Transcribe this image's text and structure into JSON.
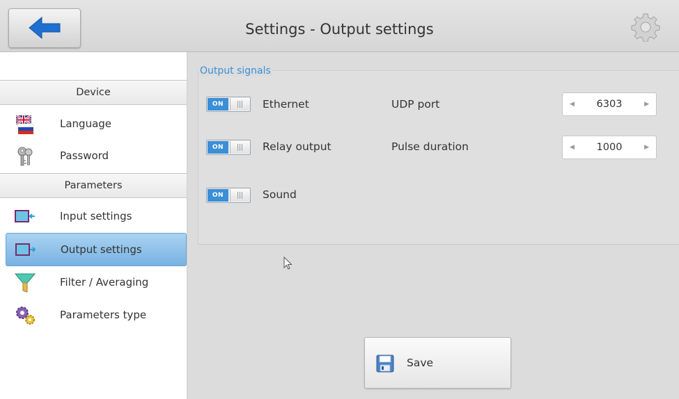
{
  "header": {
    "title": "Settings - Output settings",
    "back_icon": "left-arrow-icon",
    "settings_icon": "gear-icon"
  },
  "sidebar": {
    "sections": [
      {
        "label": "Device",
        "items": [
          {
            "label": "Language",
            "icon": "flags-icon",
            "active": false
          },
          {
            "label": "Password",
            "icon": "keys-icon",
            "active": false
          }
        ]
      },
      {
        "label": "Parameters",
        "items": [
          {
            "label": "Input settings",
            "icon": "input-monitor-icon",
            "active": false
          },
          {
            "label": "Output settings",
            "icon": "output-monitor-icon",
            "active": true
          },
          {
            "label": "Filter / Averaging",
            "icon": "funnel-icon",
            "active": false
          },
          {
            "label": "Parameters type",
            "icon": "gears-icon",
            "active": false
          }
        ]
      }
    ]
  },
  "main": {
    "group_title": "Output signals",
    "rows": [
      {
        "toggle": "ON",
        "enabled": true,
        "label": "Ethernet",
        "param_label": "UDP port",
        "param_value": "6303"
      },
      {
        "toggle": "ON",
        "enabled": true,
        "label": "Relay output",
        "param_label": "Pulse duration",
        "param_value": "1000"
      },
      {
        "toggle": "ON",
        "enabled": true,
        "label": "Sound"
      }
    ],
    "save_label": "Save"
  },
  "colors": {
    "accent": "#3b8fd6",
    "active_item": "#8ec2ea",
    "legend_text": "#3a8fd9"
  }
}
